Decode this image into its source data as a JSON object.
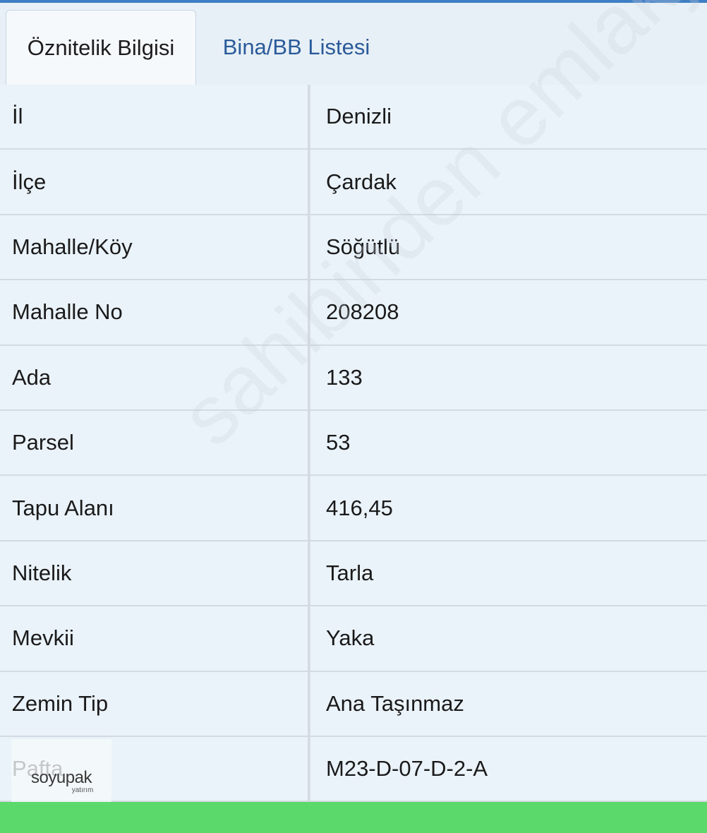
{
  "tabs": [
    {
      "label": "Öznitelik Bilgisi",
      "active": true
    },
    {
      "label": "Bina/BB Listesi",
      "active": false
    }
  ],
  "rows": [
    {
      "label": "İl",
      "value": "Denizli"
    },
    {
      "label": "İlçe",
      "value": "Çardak"
    },
    {
      "label": "Mahalle/Köy",
      "value": "Söğütlü"
    },
    {
      "label": "Mahalle No",
      "value": "208208"
    },
    {
      "label": "Ada",
      "value": "133"
    },
    {
      "label": "Parsel",
      "value": "53"
    },
    {
      "label": "Tapu Alanı",
      "value": "416,45"
    },
    {
      "label": "Nitelik",
      "value": "Tarla"
    },
    {
      "label": "Mevkii",
      "value": "Yaka"
    },
    {
      "label": "Zemin Tip",
      "value": "Ana Taşınmaz"
    },
    {
      "label": "Pafta",
      "value": "M23-D-07-D-2-A"
    }
  ],
  "watermark": "sahibinden emlakjet.com",
  "logo": {
    "name": "soyupak",
    "tagline": "yatırım"
  },
  "colors": {
    "accent": "#3f7fc4",
    "footer": "#5bd96a",
    "tab_inactive_text": "#2a5a9a"
  }
}
